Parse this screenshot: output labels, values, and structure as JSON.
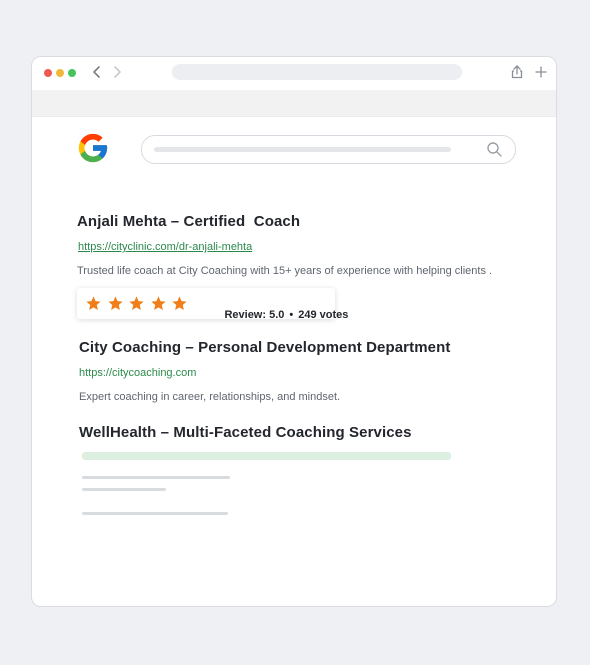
{
  "results": [
    {
      "title": "Anjali Mehta – Certified  Coach",
      "url": "https://cityclinic.com/dr-anjali-mehta",
      "description": "Trusted life coach at City Coaching with 15+ years of experience with helping clients ."
    },
    {
      "title": "City Coaching – Personal Development Department",
      "url": "https://citycoaching.com",
      "description": "Expert coaching in career, relationships, and mindset."
    },
    {
      "title": "WellHealth – Multi-Faceted Coaching Services"
    }
  ],
  "rating": {
    "stars": 5,
    "review_label": "Review: 5.0",
    "separator": "•",
    "votes_label": "249 votes"
  },
  "icons": {
    "back": "chevron-left-icon",
    "forward": "chevron-right-icon",
    "share": "share-icon",
    "new_tab": "plus-icon",
    "search": "search-icon",
    "logo": "google-logo"
  },
  "colors": {
    "star": "#f07f1a",
    "link": "#2b8a4b",
    "highlight_bar": "#dcefe1"
  }
}
